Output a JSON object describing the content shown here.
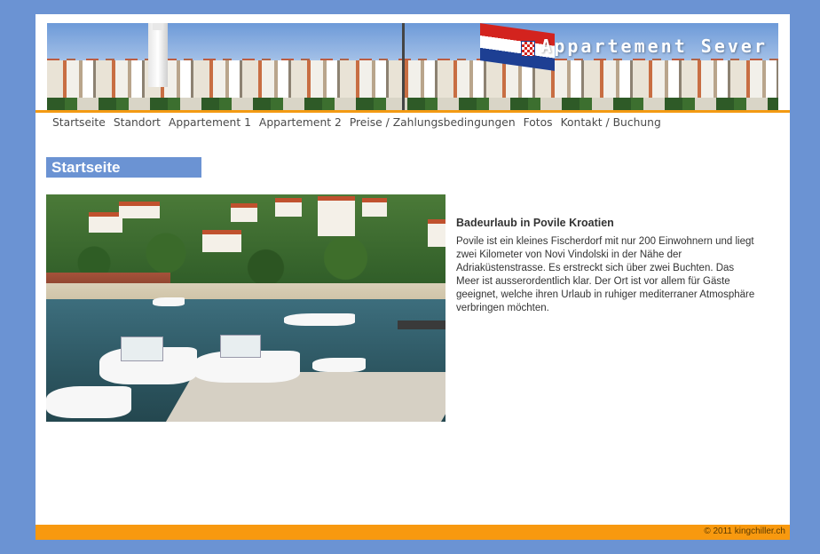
{
  "banner": {
    "title": "Appartement Sever"
  },
  "nav": {
    "items": [
      {
        "label": "Startseite"
      },
      {
        "label": "Standort"
      },
      {
        "label": "Appartement 1"
      },
      {
        "label": "Appartement 2"
      },
      {
        "label": "Preise / Zahlungsbedingungen"
      },
      {
        "label": "Fotos"
      },
      {
        "label": "Kontakt / Buchung"
      }
    ]
  },
  "main": {
    "heading": "Startseite",
    "title": "Badeurlaub in Povile Kroatien",
    "body": "Povile ist ein kleines Fischerdorf mit nur 200 Einwohnern und liegt zwei Kilometer von Novi Vindolski in der Nähe der Adriaküstenstrasse. Es erstreckt sich über zwei Buchten. Das Meer ist ausserordentlich klar. Der Ort ist vor allem für Gäste geeignet, welche ihren Urlaub in ruhiger mediterraner Atmosphäre verbringen möchten."
  },
  "footer": {
    "copyright": "© 2011 kingchiller.ch"
  },
  "colors": {
    "background": "#6b93d3",
    "accent": "#f39a13",
    "heading_bg": "#6b93d3"
  }
}
